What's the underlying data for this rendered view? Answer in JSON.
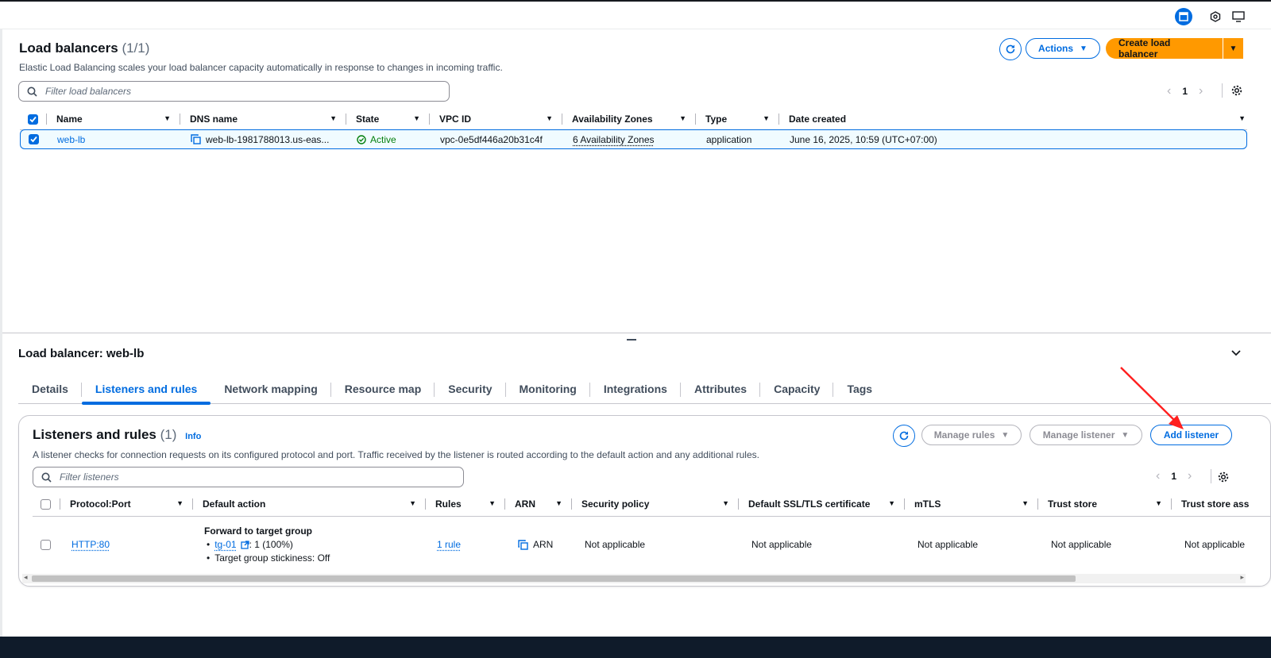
{
  "topbar": {
    "icons": [
      "panel-icon",
      "settings-hex-icon",
      "display-icon"
    ]
  },
  "load_balancers": {
    "title": "Load balancers",
    "count": "(1/1)",
    "description": "Elastic Load Balancing scales your load balancer capacity automatically in response to changes in incoming traffic.",
    "actions_label": "Actions",
    "create_label": "Create load balancer",
    "filter_placeholder": "Filter load balancers",
    "page": "1",
    "columns": [
      "Name",
      "DNS name",
      "State",
      "VPC ID",
      "Availability Zones",
      "Type",
      "Date created"
    ],
    "row": {
      "name": "web-lb",
      "dns": "web-lb-1981788013.us-eas...",
      "state": "Active",
      "vpc": "vpc-0e5df446a20b31c4f",
      "azs": "6 Availability Zones",
      "type": "application",
      "date": "June 16, 2025, 10:59 (UTC+07:00)"
    }
  },
  "detail": {
    "title": "Load balancer: web-lb",
    "tabs": [
      "Details",
      "Listeners and rules",
      "Network mapping",
      "Resource map",
      "Security",
      "Monitoring",
      "Integrations",
      "Attributes",
      "Capacity",
      "Tags"
    ],
    "active_tab": "Listeners and rules"
  },
  "listeners": {
    "title": "Listeners and rules",
    "count": "(1)",
    "info": "Info",
    "description": "A listener checks for connection requests on its configured protocol and port. Traffic received by the listener is routed according to the default action and any additional rules.",
    "manage_rules": "Manage rules",
    "manage_listener": "Manage listener",
    "add_listener": "Add listener",
    "filter_placeholder": "Filter listeners",
    "page": "1",
    "columns": [
      "Protocol:Port",
      "Default action",
      "Rules",
      "ARN",
      "Security policy",
      "Default SSL/TLS certificate",
      "mTLS",
      "Trust store",
      "Trust store ass"
    ],
    "row": {
      "protocol_port": "HTTP:80",
      "action_title": "Forward to target group",
      "tg_name": "tg-01",
      "tg_weight": ": 1 (100%)",
      "stickiness": "Target group stickiness: Off",
      "rules": "1 rule",
      "arn": "ARN",
      "security_policy": "Not applicable",
      "ssl_cert": "Not applicable",
      "mtls": "Not applicable",
      "trust_store": "Not applicable",
      "trust_store_assoc": "Not applicable"
    }
  },
  "colors": {
    "accent": "#006ce0",
    "primary_button": "#ff9900",
    "success": "#037f0c",
    "annotation_arrow": "#ff1f1f"
  }
}
